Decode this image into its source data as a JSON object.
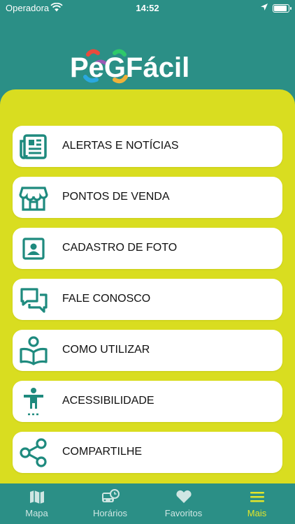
{
  "status": {
    "carrier": "Operadora",
    "time": "14:52"
  },
  "brand": {
    "logo_text": "PeGFácil",
    "colors": {
      "teal": "#2b8f86",
      "yellow": "#d9dd20",
      "icon": "#1e8a7e"
    }
  },
  "menu": {
    "items": [
      {
        "label": "ALERTAS E NOTÍCIAS",
        "icon": "newspaper-icon"
      },
      {
        "label": "PONTOS DE VENDA",
        "icon": "store-icon"
      },
      {
        "label": " CADASTRO DE FOTO",
        "icon": "photo-id-icon"
      },
      {
        "label": "FALE CONOSCO",
        "icon": "chat-bubbles-icon"
      },
      {
        "label": "COMO UTILIZAR",
        "icon": "reading-person-icon"
      },
      {
        "label": "ACESSIBILIDADE",
        "icon": "accessibility-icon"
      },
      {
        "label": "COMPARTILHE",
        "icon": "share-icon"
      }
    ]
  },
  "tabs": [
    {
      "label": "Mapa",
      "icon": "map-icon",
      "active": false
    },
    {
      "label": "Horários",
      "icon": "bus-clock-icon",
      "active": false
    },
    {
      "label": "Favoritos",
      "icon": "heart-icon",
      "active": false
    },
    {
      "label": "Mais",
      "icon": "hamburger-menu-icon",
      "active": true
    }
  ]
}
